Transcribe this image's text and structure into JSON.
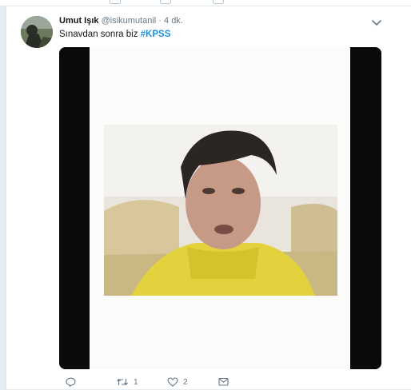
{
  "tweet": {
    "display_name": "Umut Işık",
    "handle": "@isikumutanil",
    "separator": "·",
    "timestamp": "4 dk.",
    "text": "Sınavdan sonra biz ",
    "hashtag": "#KPSS"
  },
  "actions": {
    "reply_count": "",
    "retweet_count": "1",
    "like_count": "2"
  },
  "icons": {
    "reply": "reply-icon",
    "retweet": "retweet-icon",
    "like": "heart-icon",
    "message": "envelope-icon",
    "menu": "chevron-down-icon"
  },
  "colors": {
    "background": "#e6ecf0",
    "link": "#1b95e0",
    "secondary_text": "#657786",
    "primary_text": "#14171a"
  }
}
